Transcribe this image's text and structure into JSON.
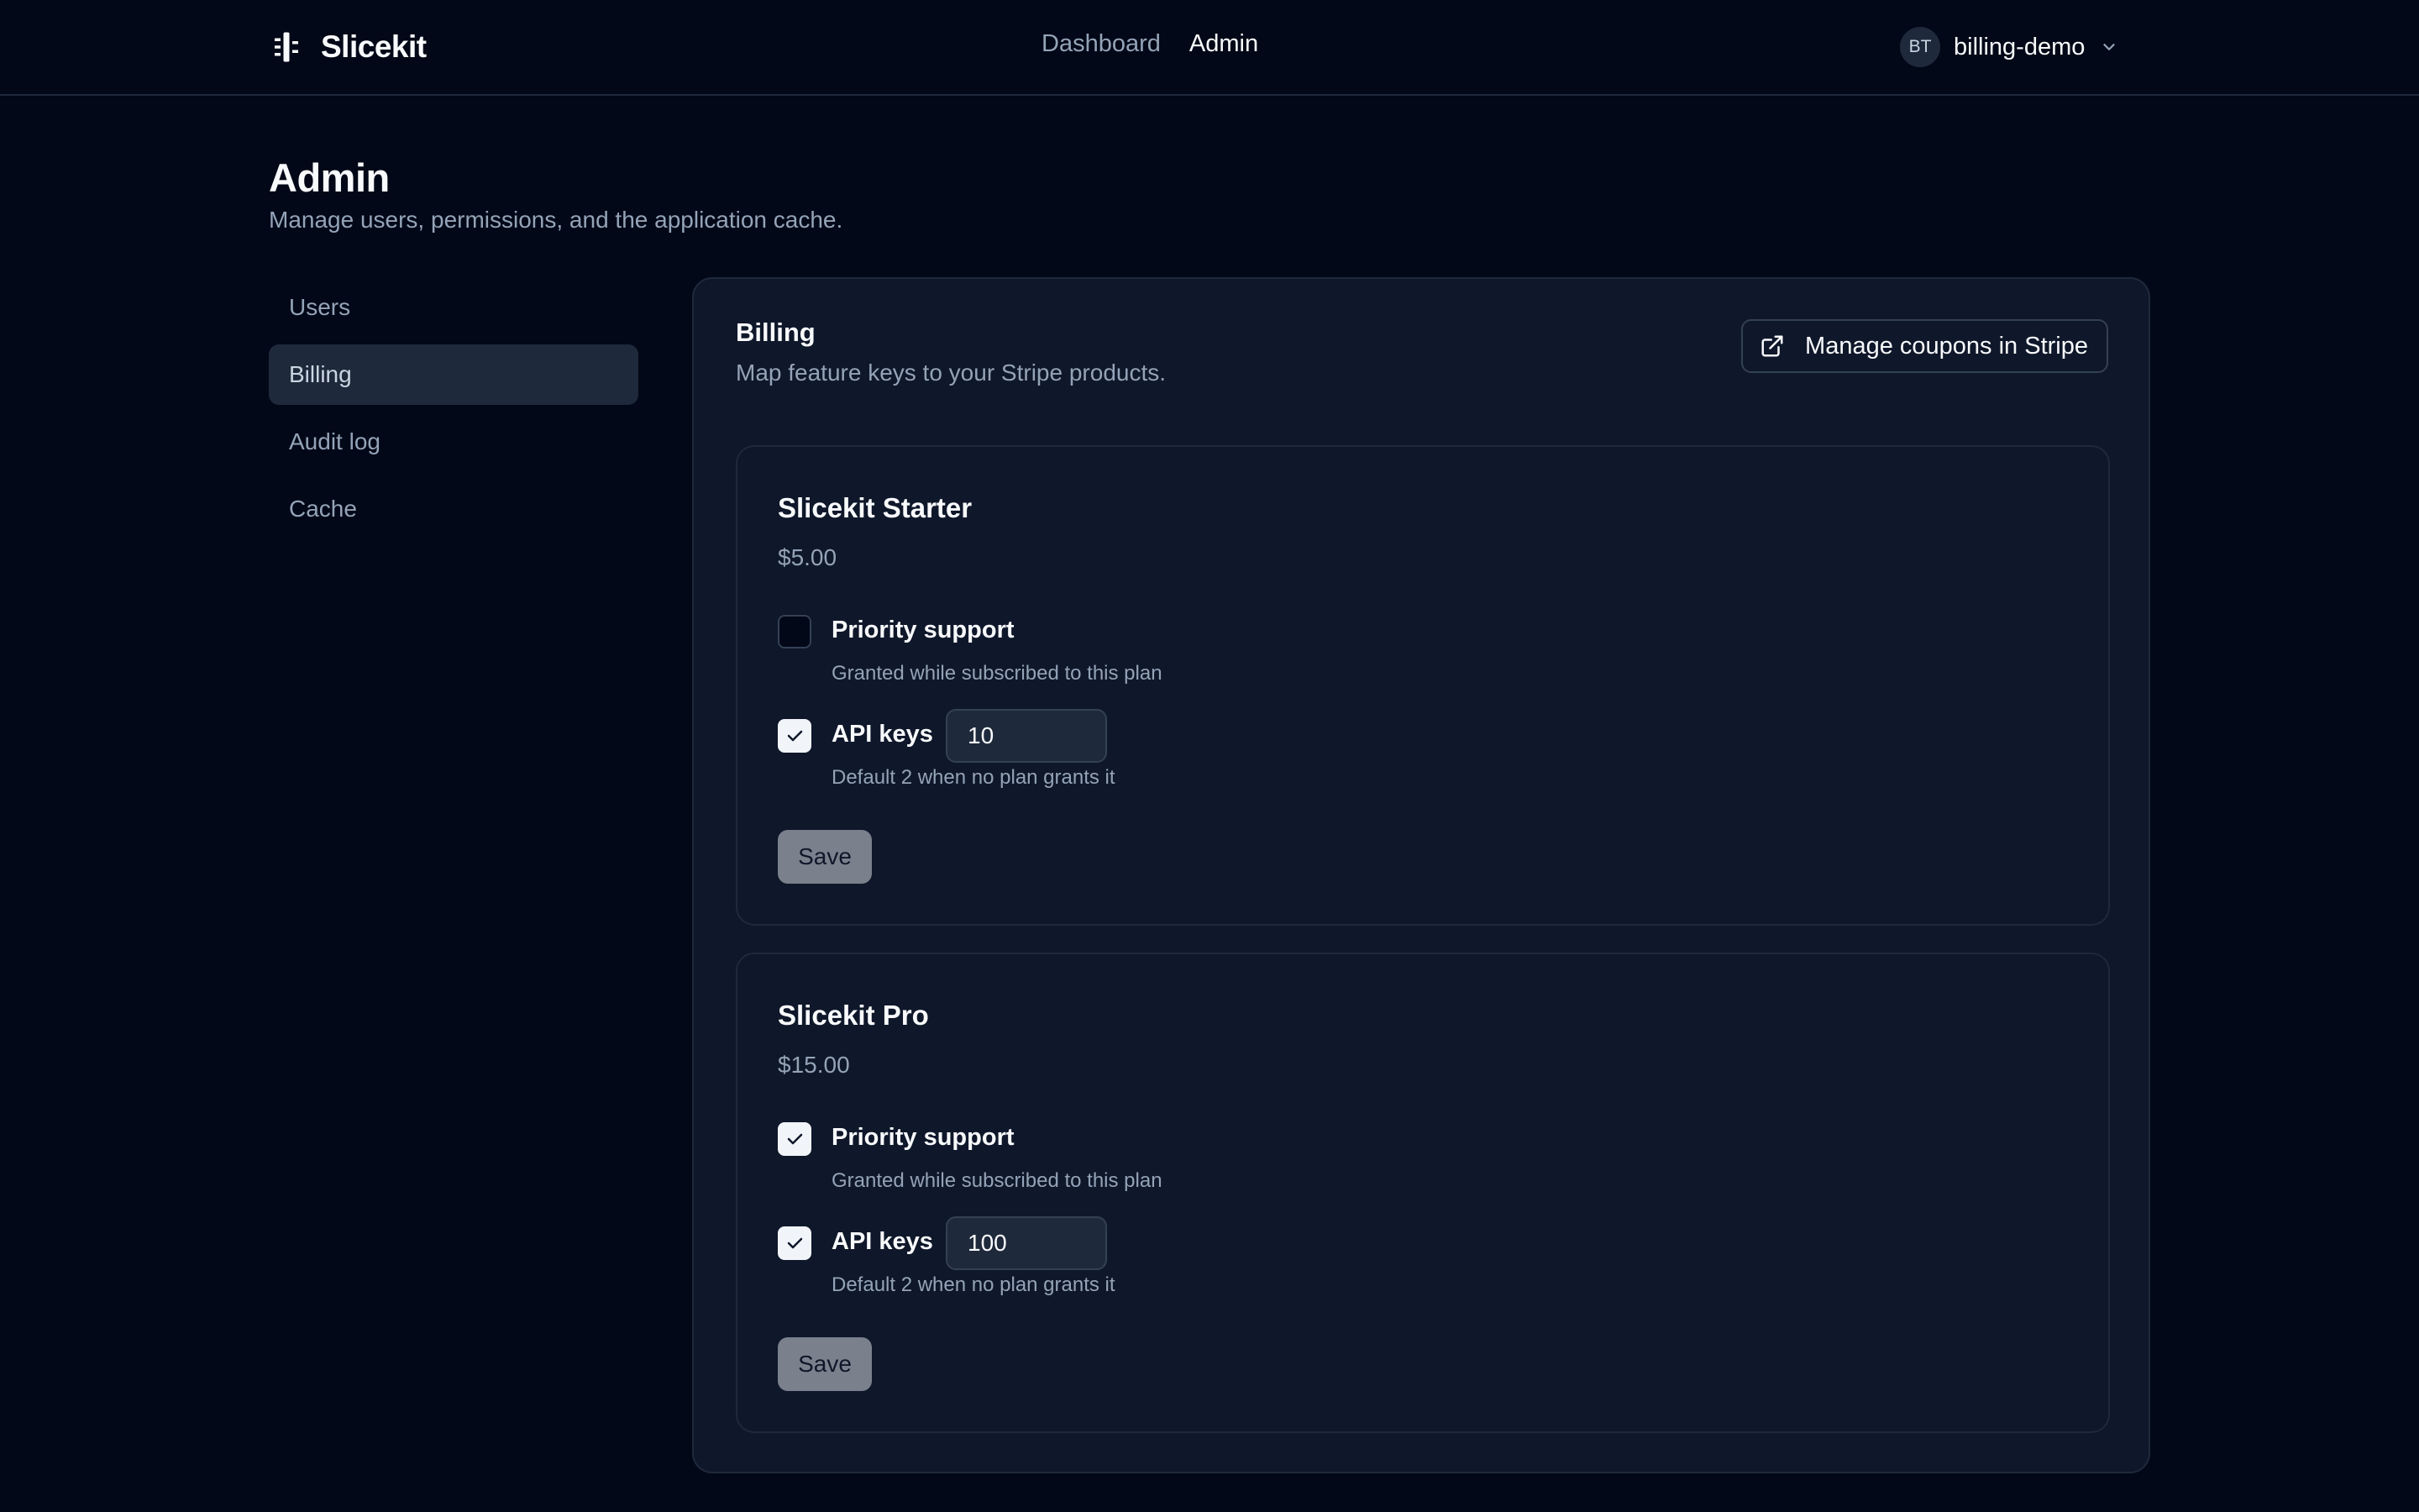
{
  "header": {
    "brand": "Slicekit",
    "nav": [
      {
        "label": "Dashboard",
        "active": false
      },
      {
        "label": "Admin",
        "active": true
      }
    ],
    "user": {
      "initials": "BT",
      "name": "billing-demo"
    }
  },
  "page": {
    "title": "Admin",
    "subtitle": "Manage users, permissions, and the application cache."
  },
  "sidebar": {
    "items": [
      {
        "label": "Users",
        "active": false
      },
      {
        "label": "Billing",
        "active": true
      },
      {
        "label": "Audit log",
        "active": false
      },
      {
        "label": "Cache",
        "active": false
      }
    ]
  },
  "billing": {
    "title": "Billing",
    "subtitle": "Map feature keys to your Stripe products.",
    "stripe_button": "Manage coupons in Stripe",
    "plans": [
      {
        "name": "Slicekit Starter",
        "price": "$5.00",
        "priority_support": {
          "label": "Priority support",
          "checked": false,
          "hint": "Granted while subscribed to this plan"
        },
        "api_keys": {
          "label": "API keys",
          "checked": true,
          "value": "10",
          "hint": "Default 2 when no plan grants it"
        },
        "save_label": "Save"
      },
      {
        "name": "Slicekit Pro",
        "price": "$15.00",
        "priority_support": {
          "label": "Priority support",
          "checked": true,
          "hint": "Granted while subscribed to this plan"
        },
        "api_keys": {
          "label": "API keys",
          "checked": true,
          "value": "100",
          "hint": "Default 2 when no plan grants it"
        },
        "save_label": "Save"
      }
    ]
  },
  "icons": {
    "brand": "slicekit-logo-icon",
    "external_link": "external-link-icon",
    "chevron": "chevron-down-icon",
    "check": "check-icon"
  },
  "colors": {
    "background": "#020817",
    "card": "#0f172a",
    "border": "#1e293b",
    "muted_text": "#94a3b8",
    "save_button": "#7b818c"
  }
}
